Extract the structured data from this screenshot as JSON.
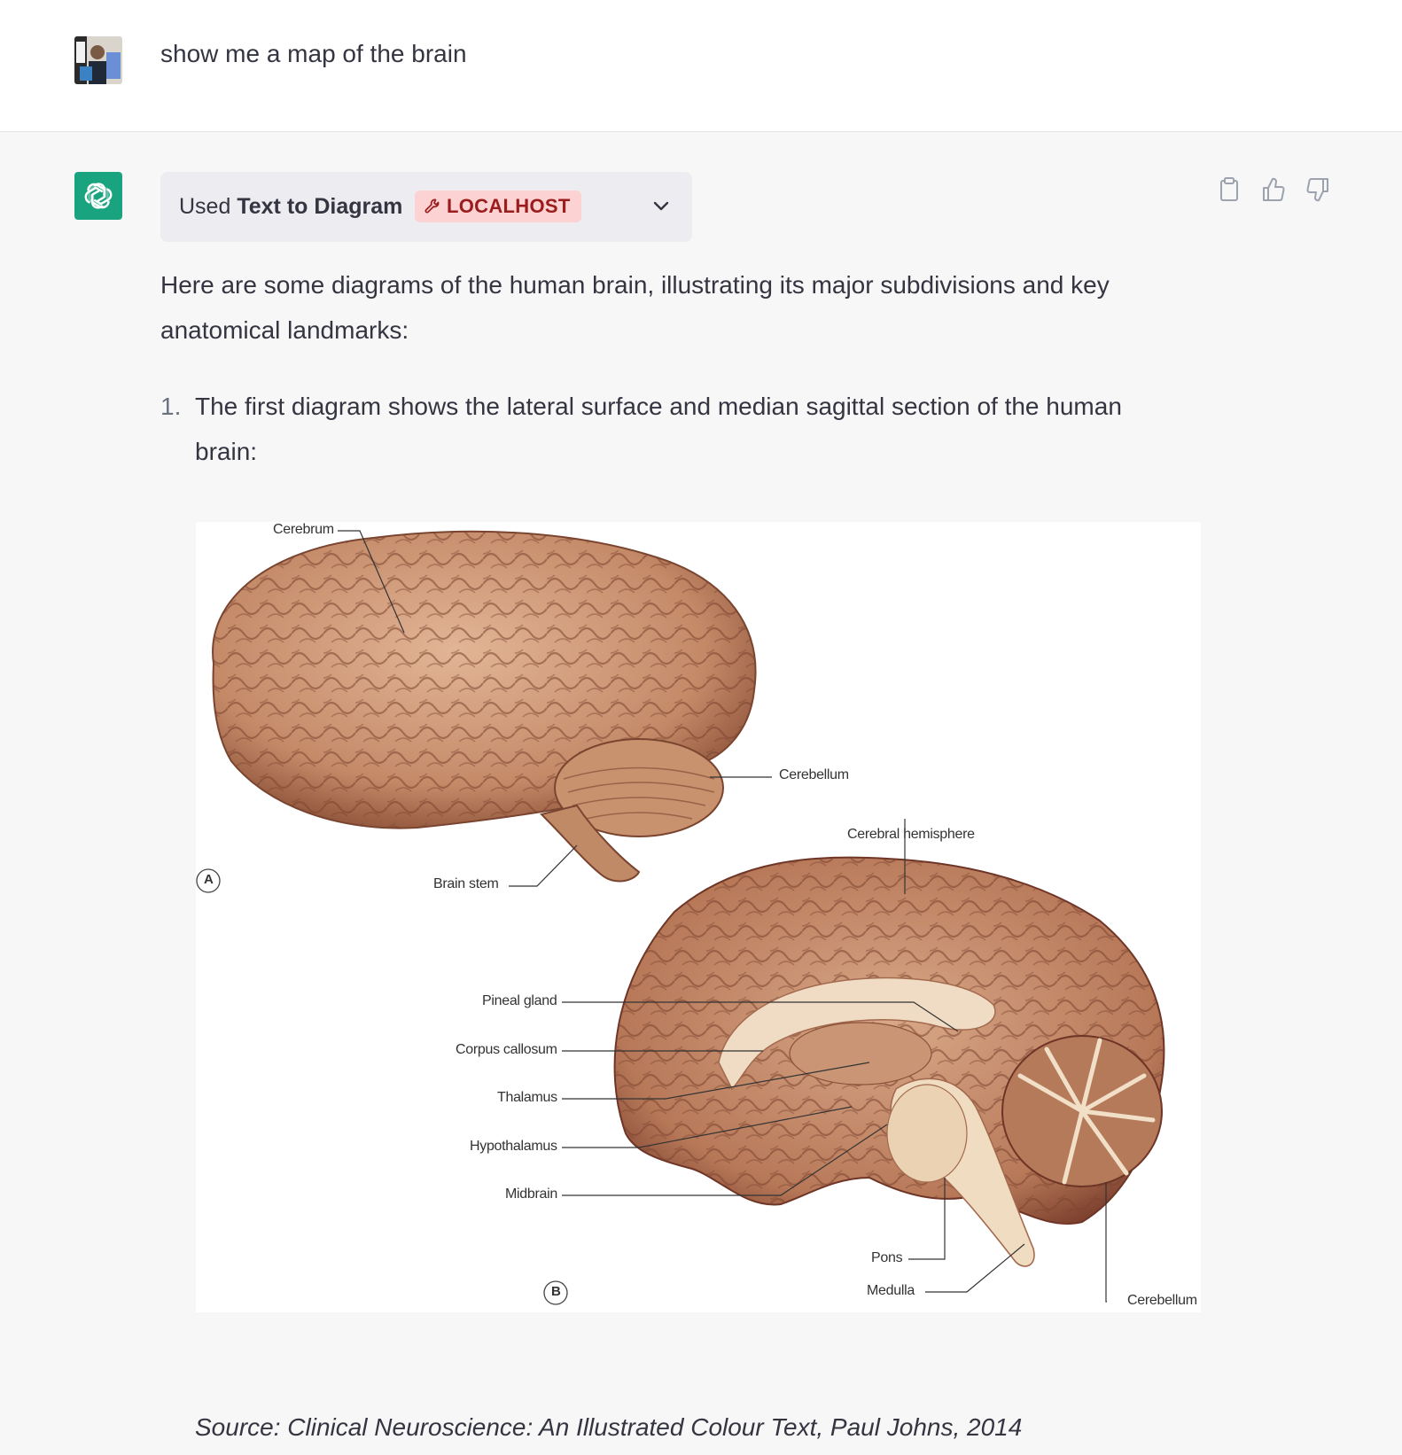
{
  "user_message": {
    "text": "show me a map of the brain"
  },
  "plugin": {
    "prefix": "Used",
    "name": "Text to Diagram",
    "badge": "LOCALHOST"
  },
  "response": {
    "intro": "Here are some diagrams of the human brain, illustrating its major subdivisions and key anatomical landmarks:",
    "list_number": "1.",
    "list_text": "The first diagram shows the lateral surface and median sagittal section of the human brain:",
    "source": "Source: Clinical Neuroscience: An Illustrated Colour Text, Paul Johns, 2014"
  },
  "figure": {
    "panel_a": "A",
    "panel_b": "B",
    "labels": {
      "cerebrum": "Cerebrum",
      "cerebellum_a": "Cerebellum",
      "brain_stem": "Brain stem",
      "cerebral_hemisphere": "Cerebral hemisphere",
      "pineal_gland": "Pineal gland",
      "corpus_callosum": "Corpus callosum",
      "thalamus": "Thalamus",
      "hypothalamus": "Hypothalamus",
      "midbrain": "Midbrain",
      "pons": "Pons",
      "medulla": "Medulla",
      "cerebellum_b": "Cerebellum"
    }
  },
  "icons": {
    "copy": "clipboard-icon",
    "thumbs_up": "thumbs-up-icon",
    "thumbs_down": "thumbs-down-icon",
    "chevron": "chevron-down-icon",
    "plugin": "wrench-icon",
    "bot": "openai-logo-icon"
  },
  "colors": {
    "bot_avatar": "#19a37f",
    "badge_bg": "#fcd2d2",
    "badge_text": "#9b1c1c"
  }
}
